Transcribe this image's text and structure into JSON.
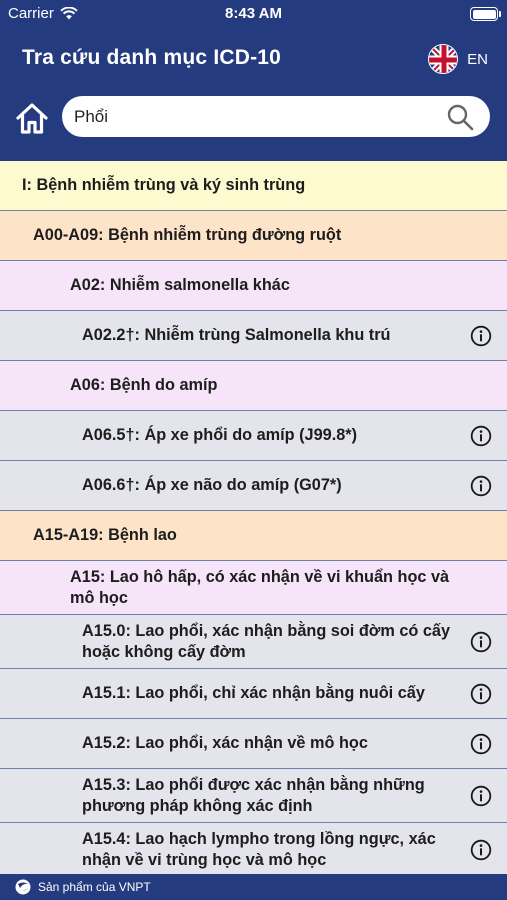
{
  "status_bar": {
    "carrier": "Carrier",
    "time": "8:43 AM"
  },
  "header": {
    "title": "Tra cứu danh mục ICD-10",
    "language": "EN"
  },
  "search": {
    "value": "Phổi",
    "placeholder": ""
  },
  "rows": [
    {
      "level": 0,
      "text": "I: Bệnh nhiễm trùng và ký sinh trùng",
      "info": false
    },
    {
      "level": 1,
      "text": "A00-A09: Bệnh nhiễm trùng đường ruột",
      "info": false
    },
    {
      "level": 2,
      "text": "A02: Nhiễm salmonella khác",
      "info": false
    },
    {
      "level": 3,
      "text": "A02.2†: Nhiễm trùng Salmonella khu trú",
      "info": true
    },
    {
      "level": 2,
      "text": "A06: Bệnh do amíp",
      "info": false
    },
    {
      "level": 3,
      "text": "A06.5†: Áp xe phổi do amíp (J99.8*)",
      "info": true
    },
    {
      "level": 3,
      "text": "A06.6†: Áp xe não do amíp (G07*)",
      "info": true
    },
    {
      "level": 1,
      "text": "A15-A19: Bệnh lao",
      "info": false
    },
    {
      "level": 2,
      "text": "A15: Lao hô hấp, có xác nhận về vi khuẩn học và mô học",
      "info": false
    },
    {
      "level": 3,
      "text": "A15.0: Lao phổi, xác nhận bằng soi đờm có cấy hoặc không cấy đờm",
      "info": true
    },
    {
      "level": 3,
      "text": "A15.1: Lao phổi, chỉ xác nhận bằng nuôi cấy",
      "info": true
    },
    {
      "level": 3,
      "text": "A15.2: Lao phổi, xác nhận về mô học",
      "info": true
    },
    {
      "level": 3,
      "text": "A15.3: Lao phổi được xác nhận bằng những phương pháp không xác định",
      "info": true
    },
    {
      "level": 3,
      "text": "A15.4: Lao hạch lympho trong lồng ngực, xác nhận về vi trùng học và mô học",
      "info": true
    }
  ],
  "footer": {
    "text": "Sản phẩm của VNPT"
  },
  "colors": {
    "header": "#253b7f",
    "chapter": "#fdfad0",
    "group": "#fde3c8",
    "category": "#f6e4f9",
    "code": "#e4e4ec"
  },
  "icons": {
    "home": "home-icon",
    "search": "search-icon",
    "info": "info-icon",
    "flag": "uk-flag-icon",
    "logo": "vnpt-logo-icon"
  }
}
